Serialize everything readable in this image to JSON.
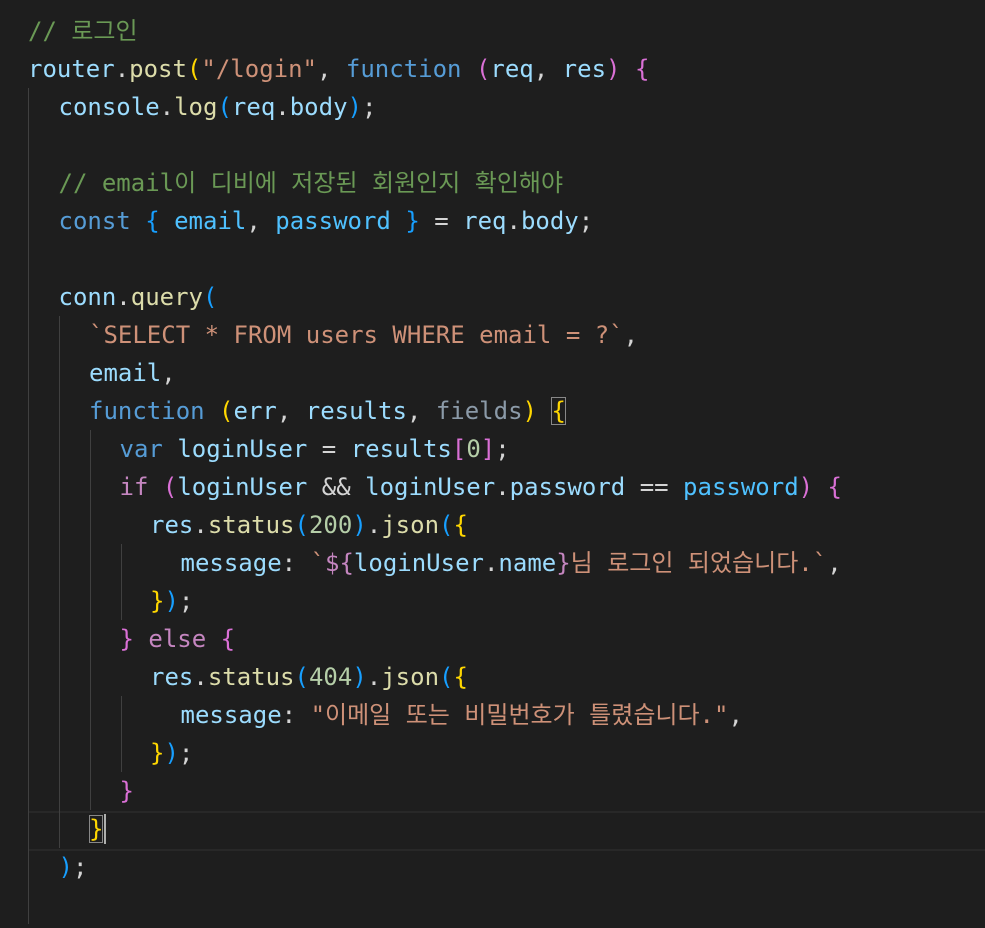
{
  "lines": [
    [
      {
        "t": "// 로그인",
        "c": "#6a9955"
      }
    ],
    [
      {
        "t": "router",
        "c": "#9cdcfe"
      },
      {
        "t": ".",
        "c": "#d4d4d4"
      },
      {
        "t": "post",
        "c": "#dcdcaa"
      },
      {
        "t": "(",
        "c": "#ffd700"
      },
      {
        "t": "\"/login\"",
        "c": "#ce9178"
      },
      {
        "t": ", ",
        "c": "#d4d4d4"
      },
      {
        "t": "function",
        "c": "#569cd6"
      },
      {
        "t": " ",
        "c": "#d4d4d4"
      },
      {
        "t": "(",
        "c": "#da70d6"
      },
      {
        "t": "req",
        "c": "#9cdcfe"
      },
      {
        "t": ", ",
        "c": "#d4d4d4"
      },
      {
        "t": "res",
        "c": "#9cdcfe"
      },
      {
        "t": ")",
        "c": "#da70d6"
      },
      {
        "t": " ",
        "c": "#d4d4d4"
      },
      {
        "t": "{",
        "c": "#da70d6"
      }
    ],
    [
      {
        "t": "console",
        "c": "#9cdcfe"
      },
      {
        "t": ".",
        "c": "#d4d4d4"
      },
      {
        "t": "log",
        "c": "#dcdcaa"
      },
      {
        "t": "(",
        "c": "#179fff"
      },
      {
        "t": "req",
        "c": "#9cdcfe"
      },
      {
        "t": ".",
        "c": "#d4d4d4"
      },
      {
        "t": "body",
        "c": "#9cdcfe"
      },
      {
        "t": ")",
        "c": "#179fff"
      },
      {
        "t": ";",
        "c": "#d4d4d4"
      }
    ],
    [],
    [
      {
        "t": "// email이 디비에 저장된 회원인지 확인해야",
        "c": "#6a9955"
      }
    ],
    [
      {
        "t": "const",
        "c": "#569cd6"
      },
      {
        "t": " ",
        "c": "#d4d4d4"
      },
      {
        "t": "{",
        "c": "#179fff"
      },
      {
        "t": " ",
        "c": "#d4d4d4"
      },
      {
        "t": "email",
        "c": "#4fc1ff"
      },
      {
        "t": ", ",
        "c": "#d4d4d4"
      },
      {
        "t": "password",
        "c": "#4fc1ff"
      },
      {
        "t": " ",
        "c": "#d4d4d4"
      },
      {
        "t": "}",
        "c": "#179fff"
      },
      {
        "t": " = ",
        "c": "#d4d4d4"
      },
      {
        "t": "req",
        "c": "#9cdcfe"
      },
      {
        "t": ".",
        "c": "#d4d4d4"
      },
      {
        "t": "body",
        "c": "#9cdcfe"
      },
      {
        "t": ";",
        "c": "#d4d4d4"
      }
    ],
    [],
    [
      {
        "t": "conn",
        "c": "#9cdcfe"
      },
      {
        "t": ".",
        "c": "#d4d4d4"
      },
      {
        "t": "query",
        "c": "#dcdcaa"
      },
      {
        "t": "(",
        "c": "#179fff"
      }
    ],
    [
      {
        "t": "`SELECT * FROM users WHERE email = ?`",
        "c": "#ce9178"
      },
      {
        "t": ",",
        "c": "#d4d4d4"
      }
    ],
    [
      {
        "t": "email",
        "c": "#9cdcfe"
      },
      {
        "t": ",",
        "c": "#d4d4d4"
      }
    ],
    [
      {
        "t": "function",
        "c": "#569cd6"
      },
      {
        "t": " ",
        "c": "#d4d4d4"
      },
      {
        "t": "(",
        "c": "#ffd700"
      },
      {
        "t": "err",
        "c": "#9cdcfe"
      },
      {
        "t": ", ",
        "c": "#d4d4d4"
      },
      {
        "t": "results",
        "c": "#9cdcfe"
      },
      {
        "t": ", ",
        "c": "#d4d4d4"
      },
      {
        "t": "fields",
        "c": "#8b9aa8"
      },
      {
        "t": ")",
        "c": "#ffd700"
      },
      {
        "t": " ",
        "c": "#d4d4d4"
      },
      {
        "t": "{",
        "c": "#ffd700",
        "box": true
      }
    ],
    [
      {
        "t": "var",
        "c": "#569cd6"
      },
      {
        "t": " ",
        "c": "#d4d4d4"
      },
      {
        "t": "loginUser",
        "c": "#9cdcfe"
      },
      {
        "t": " = ",
        "c": "#d4d4d4"
      },
      {
        "t": "results",
        "c": "#9cdcfe"
      },
      {
        "t": "[",
        "c": "#da70d6"
      },
      {
        "t": "0",
        "c": "#b5cea8"
      },
      {
        "t": "]",
        "c": "#da70d6"
      },
      {
        "t": ";",
        "c": "#d4d4d4"
      }
    ],
    [
      {
        "t": "if",
        "c": "#c586c0"
      },
      {
        "t": " ",
        "c": "#d4d4d4"
      },
      {
        "t": "(",
        "c": "#da70d6"
      },
      {
        "t": "loginUser",
        "c": "#9cdcfe"
      },
      {
        "t": " && ",
        "c": "#d4d4d4"
      },
      {
        "t": "loginUser",
        "c": "#9cdcfe"
      },
      {
        "t": ".",
        "c": "#d4d4d4"
      },
      {
        "t": "password",
        "c": "#9cdcfe"
      },
      {
        "t": " == ",
        "c": "#d4d4d4"
      },
      {
        "t": "password",
        "c": "#4fc1ff"
      },
      {
        "t": ")",
        "c": "#da70d6"
      },
      {
        "t": " ",
        "c": "#d4d4d4"
      },
      {
        "t": "{",
        "c": "#da70d6"
      }
    ],
    [
      {
        "t": "res",
        "c": "#9cdcfe"
      },
      {
        "t": ".",
        "c": "#d4d4d4"
      },
      {
        "t": "status",
        "c": "#dcdcaa"
      },
      {
        "t": "(",
        "c": "#179fff"
      },
      {
        "t": "200",
        "c": "#b5cea8"
      },
      {
        "t": ")",
        "c": "#179fff"
      },
      {
        "t": ".",
        "c": "#d4d4d4"
      },
      {
        "t": "json",
        "c": "#dcdcaa"
      },
      {
        "t": "(",
        "c": "#179fff"
      },
      {
        "t": "{",
        "c": "#ffd700"
      }
    ],
    [
      {
        "t": "message",
        "c": "#9cdcfe"
      },
      {
        "t": ": ",
        "c": "#d4d4d4"
      },
      {
        "t": "`",
        "c": "#ce9178"
      },
      {
        "t": "${",
        "c": "#c586c0"
      },
      {
        "t": "loginUser",
        "c": "#9cdcfe"
      },
      {
        "t": ".",
        "c": "#d4d4d4"
      },
      {
        "t": "name",
        "c": "#9cdcfe"
      },
      {
        "t": "}",
        "c": "#c586c0"
      },
      {
        "t": "님 로그인 되었습니다.`",
        "c": "#ce9178"
      },
      {
        "t": ",",
        "c": "#d4d4d4"
      }
    ],
    [
      {
        "t": "}",
        "c": "#ffd700"
      },
      {
        "t": ")",
        "c": "#179fff"
      },
      {
        "t": ";",
        "c": "#d4d4d4"
      }
    ],
    [
      {
        "t": "}",
        "c": "#da70d6"
      },
      {
        "t": " ",
        "c": "#d4d4d4"
      },
      {
        "t": "else",
        "c": "#c586c0"
      },
      {
        "t": " ",
        "c": "#d4d4d4"
      },
      {
        "t": "{",
        "c": "#da70d6"
      }
    ],
    [
      {
        "t": "res",
        "c": "#9cdcfe"
      },
      {
        "t": ".",
        "c": "#d4d4d4"
      },
      {
        "t": "status",
        "c": "#dcdcaa"
      },
      {
        "t": "(",
        "c": "#179fff"
      },
      {
        "t": "404",
        "c": "#b5cea8"
      },
      {
        "t": ")",
        "c": "#179fff"
      },
      {
        "t": ".",
        "c": "#d4d4d4"
      },
      {
        "t": "json",
        "c": "#dcdcaa"
      },
      {
        "t": "(",
        "c": "#179fff"
      },
      {
        "t": "{",
        "c": "#ffd700"
      }
    ],
    [
      {
        "t": "message",
        "c": "#9cdcfe"
      },
      {
        "t": ": ",
        "c": "#d4d4d4"
      },
      {
        "t": "\"이메일 또는 비밀번호가 틀렸습니다.\"",
        "c": "#ce9178"
      },
      {
        "t": ",",
        "c": "#d4d4d4"
      }
    ],
    [
      {
        "t": "}",
        "c": "#ffd700"
      },
      {
        "t": ")",
        "c": "#179fff"
      },
      {
        "t": ";",
        "c": "#d4d4d4"
      }
    ],
    [
      {
        "t": "}",
        "c": "#da70d6"
      }
    ],
    [
      {
        "t": "}",
        "c": "#ffd700",
        "box": true
      }
    ],
    [
      {
        "t": ")",
        "c": "#179fff"
      },
      {
        "t": ";",
        "c": "#d4d4d4"
      }
    ],
    []
  ]
}
